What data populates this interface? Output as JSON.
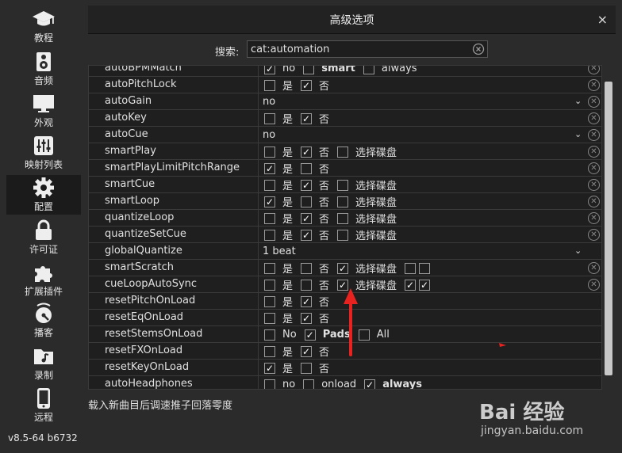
{
  "sidebar": {
    "items": [
      {
        "label": "教程",
        "icon": "graduation-cap-icon"
      },
      {
        "label": "音频",
        "icon": "speaker-icon"
      },
      {
        "label": "外观",
        "icon": "monitor-icon"
      },
      {
        "label": "映射列表",
        "icon": "sliders-icon"
      },
      {
        "label": "配置",
        "icon": "gear-icon",
        "active": true
      },
      {
        "label": "许可证",
        "icon": "lock-icon"
      },
      {
        "label": "扩展插件",
        "icon": "puzzle-icon"
      },
      {
        "label": "播客",
        "icon": "podcast-icon"
      },
      {
        "label": "录制",
        "icon": "folder-music-icon"
      },
      {
        "label": "远程",
        "icon": "phone-icon"
      }
    ],
    "version": "v8.5-64 b6732"
  },
  "dialog": {
    "title": "高级选项",
    "close": "×",
    "search_label": "搜索:",
    "search_value": "cat:automation"
  },
  "rows": [
    {
      "name": "autoBPMMatch",
      "type": "checks",
      "items": [
        {
          "checked": true,
          "label": "no"
        },
        {
          "checked": false,
          "label": "smart",
          "bold": true
        },
        {
          "checked": false,
          "label": "always"
        }
      ],
      "removable": true
    },
    {
      "name": "autoPitchLock",
      "type": "checks",
      "items": [
        {
          "checked": false,
          "label": "是"
        },
        {
          "checked": true,
          "label": "否"
        }
      ],
      "removable": true
    },
    {
      "name": "autoGain",
      "type": "select",
      "value": "no",
      "removable": true
    },
    {
      "name": "autoKey",
      "type": "checks",
      "items": [
        {
          "checked": false,
          "label": "是"
        },
        {
          "checked": true,
          "label": "否"
        }
      ],
      "removable": true
    },
    {
      "name": "autoCue",
      "type": "select",
      "value": "no",
      "removable": true
    },
    {
      "name": "smartPlay",
      "type": "checks",
      "items": [
        {
          "checked": false,
          "label": "是"
        },
        {
          "checked": true,
          "label": "否"
        },
        {
          "checked": false,
          "label": "选择碟盘"
        }
      ],
      "removable": true
    },
    {
      "name": "smartPlayLimitPitchRange",
      "type": "checks",
      "items": [
        {
          "checked": true,
          "label": "是"
        },
        {
          "checked": false,
          "label": "否"
        }
      ],
      "removable": true
    },
    {
      "name": "smartCue",
      "type": "checks",
      "items": [
        {
          "checked": false,
          "label": "是"
        },
        {
          "checked": true,
          "label": "否"
        },
        {
          "checked": false,
          "label": "选择碟盘"
        }
      ],
      "removable": true
    },
    {
      "name": "smartLoop",
      "type": "checks",
      "items": [
        {
          "checked": true,
          "label": "是"
        },
        {
          "checked": false,
          "label": "否"
        },
        {
          "checked": false,
          "label": "选择碟盘"
        }
      ],
      "removable": true
    },
    {
      "name": "quantizeLoop",
      "type": "checks",
      "items": [
        {
          "checked": false,
          "label": "是"
        },
        {
          "checked": true,
          "label": "否"
        },
        {
          "checked": false,
          "label": "选择碟盘"
        }
      ],
      "removable": true
    },
    {
      "name": "quantizeSetCue",
      "type": "checks",
      "items": [
        {
          "checked": false,
          "label": "是"
        },
        {
          "checked": true,
          "label": "否"
        },
        {
          "checked": false,
          "label": "选择碟盘"
        }
      ],
      "removable": true
    },
    {
      "name": "globalQuantize",
      "type": "select",
      "value": "1 beat",
      "removable": false
    },
    {
      "name": "smartScratch",
      "type": "checks",
      "items": [
        {
          "checked": false,
          "label": "是"
        },
        {
          "checked": false,
          "label": "否"
        },
        {
          "checked": true,
          "label": "选择碟盘"
        },
        {
          "checked": false,
          "label": ""
        },
        {
          "checked": false,
          "label": ""
        }
      ],
      "removable": true
    },
    {
      "name": "cueLoopAutoSync",
      "type": "checks",
      "items": [
        {
          "checked": false,
          "label": "是"
        },
        {
          "checked": false,
          "label": "否"
        },
        {
          "checked": true,
          "label": "选择碟盘"
        },
        {
          "checked": true,
          "label": ""
        },
        {
          "checked": true,
          "label": ""
        }
      ],
      "removable": true
    },
    {
      "name": "resetPitchOnLoad",
      "type": "checks",
      "items": [
        {
          "checked": false,
          "label": "是"
        },
        {
          "checked": true,
          "label": "否"
        }
      ],
      "removable": false
    },
    {
      "name": "resetEqOnLoad",
      "type": "checks",
      "items": [
        {
          "checked": false,
          "label": "是"
        },
        {
          "checked": true,
          "label": "否"
        }
      ],
      "removable": false
    },
    {
      "name": "resetStemsOnLoad",
      "type": "checks",
      "items": [
        {
          "checked": false,
          "label": "No"
        },
        {
          "checked": true,
          "label": "Pads",
          "bold": true
        },
        {
          "checked": false,
          "label": "All"
        }
      ],
      "removable": false
    },
    {
      "name": "resetFXOnLoad",
      "type": "checks",
      "items": [
        {
          "checked": false,
          "label": "是"
        },
        {
          "checked": true,
          "label": "否"
        }
      ],
      "removable": false
    },
    {
      "name": "resetKeyOnLoad",
      "type": "checks",
      "items": [
        {
          "checked": true,
          "label": "是"
        },
        {
          "checked": false,
          "label": "否"
        }
      ],
      "removable": false
    },
    {
      "name": "autoHeadphones",
      "type": "checks",
      "items": [
        {
          "checked": false,
          "label": "no"
        },
        {
          "checked": false,
          "label": "onload"
        },
        {
          "checked": true,
          "label": "always",
          "bold": true
        }
      ],
      "removable": false
    }
  ],
  "footer": {
    "description": "载入新曲目后调速推子回落零度"
  },
  "watermark": {
    "main": "Bai 经验",
    "sub": "jingyan.baidu.com"
  },
  "colors": {
    "arrow": "#e8231f",
    "background": "#2b2b2b",
    "table_bg": "#1f1f1f"
  }
}
